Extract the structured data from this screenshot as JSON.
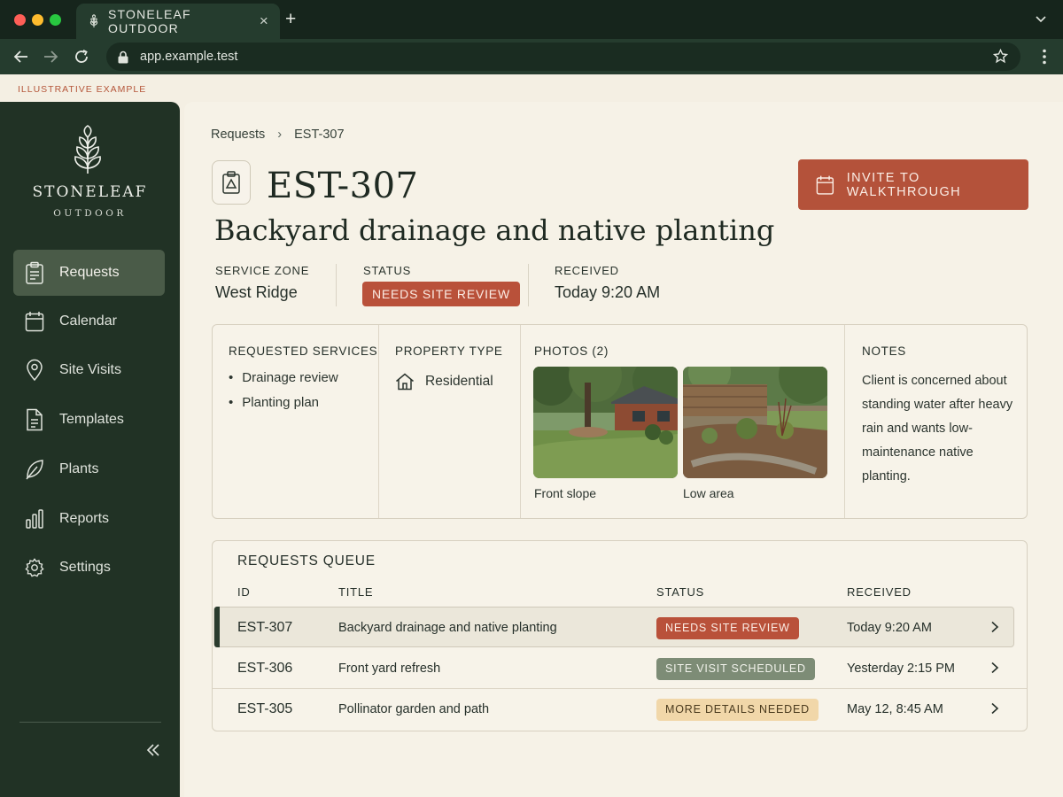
{
  "browser": {
    "tab_title": "STONELEAF OUTDOOR",
    "url": "app.example.test",
    "tab_close": "×",
    "new_tab": "+"
  },
  "banner": "ILLUSTRATIVE EXAMPLE",
  "brand": {
    "name": "STONELEAF",
    "sub": "OUTDOOR"
  },
  "sidebar": {
    "items": [
      {
        "label": "Requests",
        "icon": "clipboard-icon",
        "active": true
      },
      {
        "label": "Calendar",
        "icon": "calendar-icon"
      },
      {
        "label": "Site Visits",
        "icon": "map-pin-icon"
      },
      {
        "label": "Templates",
        "icon": "document-icon"
      },
      {
        "label": "Plants",
        "icon": "leaf-icon"
      },
      {
        "label": "Reports",
        "icon": "bar-chart-icon"
      },
      {
        "label": "Settings",
        "icon": "gear-icon"
      }
    ],
    "collapse": "«"
  },
  "breadcrumb": {
    "parent": "Requests",
    "sep": "›",
    "current": "EST-307"
  },
  "request": {
    "id": "EST-307",
    "title": "Backyard drainage and native planting",
    "invite_label": "INVITE TO WALKTHROUGH",
    "meta": {
      "zone_label": "SERVICE ZONE",
      "zone_value": "West Ridge",
      "status_label": "STATUS",
      "status_value": "NEEDS SITE REVIEW",
      "received_label": "RECEIVED",
      "received_value": "Today 9:20 AM"
    },
    "details": {
      "services_label": "REQUESTED SERVICES",
      "services": [
        "Drainage review",
        "Planting plan"
      ],
      "property_label": "PROPERTY TYPE",
      "property_value": "Residential",
      "photos_label": "PHOTOS (2)",
      "photos": [
        {
          "caption": "Front slope"
        },
        {
          "caption": "Low area"
        }
      ],
      "notes_label": "NOTES",
      "notes": "Client is concerned about standing water after heavy rain and wants low-maintenance native planting."
    }
  },
  "queue": {
    "title": "REQUESTS QUEUE",
    "headers": {
      "id": "ID",
      "title": "TITLE",
      "status": "STATUS",
      "received": "RECEIVED"
    },
    "rows": [
      {
        "id": "EST-307",
        "title": "Backyard drainage and native planting",
        "status": "NEEDS SITE REVIEW",
        "received": "Today 9:20 AM",
        "status_color": "#b9513a"
      },
      {
        "id": "EST-306",
        "title": "Front yard refresh",
        "status": "SITE VISIT SCHEDULED",
        "received": "Yesterday 2:15 PM",
        "status_color": "#7d8c76"
      },
      {
        "id": "EST-305",
        "title": "Pollinator garden and path",
        "status": "MORE DETAILS NEEDED",
        "received": "May 12, 8:45 AM",
        "status_color": "#f1d7a9"
      }
    ]
  },
  "colors": {
    "sidebar_bg": "#213225",
    "accent": "#b4523a",
    "surface": "#f6f2e7"
  }
}
